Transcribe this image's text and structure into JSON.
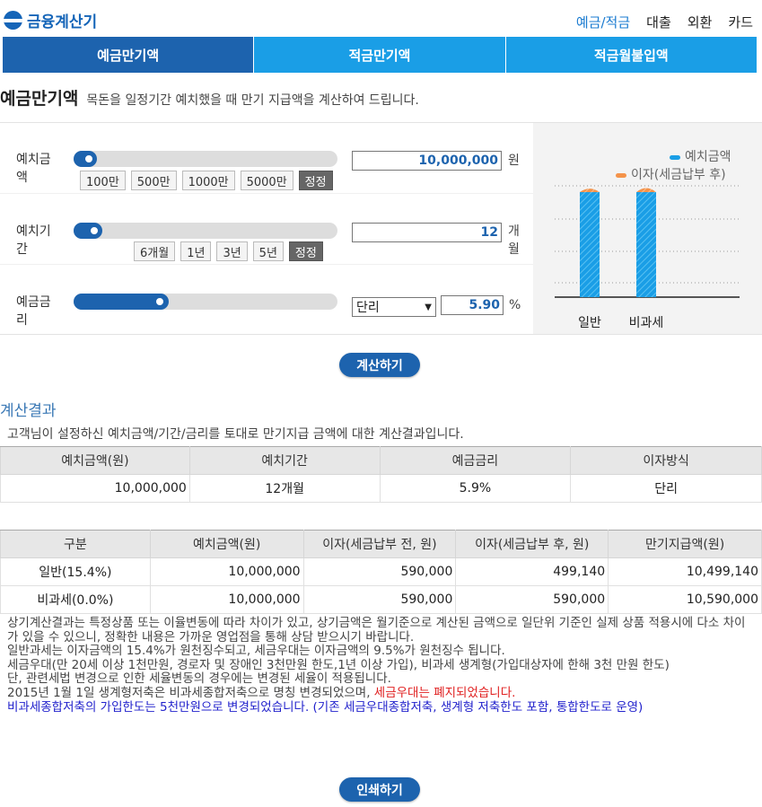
{
  "app": {
    "logo_text": "금융계산기"
  },
  "topnav": [
    "예금/적금",
    "대출",
    "외환",
    "카드"
  ],
  "tabs": [
    "예금만기액",
    "적금만기액",
    "적금월불입액"
  ],
  "page": {
    "title": "예금만기액",
    "description": "목돈을 일정기간 예치했을 때 만기 지급액을 계산하여 드립니다."
  },
  "form": {
    "deposit": {
      "label": "예치금액",
      "presets": [
        "100만",
        "500만",
        "1000만",
        "5000만"
      ],
      "reset": "정정",
      "value": "10,000,000",
      "unit": "원",
      "slider_fraction": 0.03
    },
    "period": {
      "label": "예치기간",
      "presets": [
        "6개월",
        "1년",
        "3년",
        "5년"
      ],
      "reset": "정정",
      "value": "12",
      "unit": "개월",
      "slider_fraction": 0.05
    },
    "rate": {
      "label": "예금금리",
      "method": "단리",
      "value": "5.90",
      "unit": "%",
      "slider_fraction": 0.3
    }
  },
  "chart_data": {
    "type": "bar",
    "stacked": true,
    "categories": [
      "일반",
      "비과세"
    ],
    "series": [
      {
        "name": "예치금액",
        "values": [
          10000000,
          10000000
        ]
      },
      {
        "name": "이자(세금납부 후)",
        "values": [
          499140,
          590000
        ]
      }
    ],
    "legend_position": "top-right",
    "grid": true,
    "colors": {
      "principal": "#1a9ee6",
      "interest": "#f4934a"
    }
  },
  "actions": {
    "calculate": "계산하기",
    "print": "인쇄하기"
  },
  "result": {
    "title": "계산결과",
    "description": "고객님이 설정하신 예치금액/기간/금리를 토대로 만기지급 금액에 대한 계산결과입니다.",
    "summary_headers": [
      "예치금액(원)",
      "예치기간",
      "예금금리",
      "이자방식"
    ],
    "summary_row": [
      "10,000,000",
      "12개월",
      "5.9%",
      "단리"
    ],
    "detail_headers": [
      "구분",
      "예치금액(원)",
      "이자(세금납부 전, 원)",
      "이자(세금납부 후, 원)",
      "만기지급액(원)"
    ],
    "detail_rows": [
      [
        "일반(15.4%)",
        "10,000,000",
        "590,000",
        "499,140",
        "10,499,140"
      ],
      [
        "비과세(0.0%)",
        "10,000,000",
        "590,000",
        "590,000",
        "10,590,000"
      ]
    ]
  },
  "notes": {
    "n1": "상기계산결과는 특정상품 또는 이율변동에 따라 차이가 있고, 상기금액은 월기준으로 계산된 금액으로 일단위 기준인 실제 상품 적용시에 다소 차이가 있을 수 있으니, 정확한 내용은 가까운 영업점을 통해 상담 받으시기 바랍니다.",
    "n2": "일반과세는 이자금액의 15.4%가 원천징수되고, 세금우대는 이자금액의 9.5%가 원천징수 됩니다.",
    "n3": "세금우대(만 20세 이상 1천만원, 경로자 및 장애인 3천만원 한도,1년 이상 가입), 비과세 생계형(가입대상자에 한해 3천 만원 한도)",
    "n4": "단, 관련세법 변경으로 인한 세율변동의 경우에는 변경된 세율이 적용됩니다.",
    "n5a": "2015년 1월 1일 생계형저축은 비과세종합저축으로 명칭 변경되었으며, ",
    "n5b": "세금우대는 폐지되었습니다.",
    "n6": "비과세종합저축의 가입한도는 5천만원으로 변경되었습니다. (기존 세금우대종합저축, 생계형 저축한도 포함, 통합한도로 운영)"
  }
}
